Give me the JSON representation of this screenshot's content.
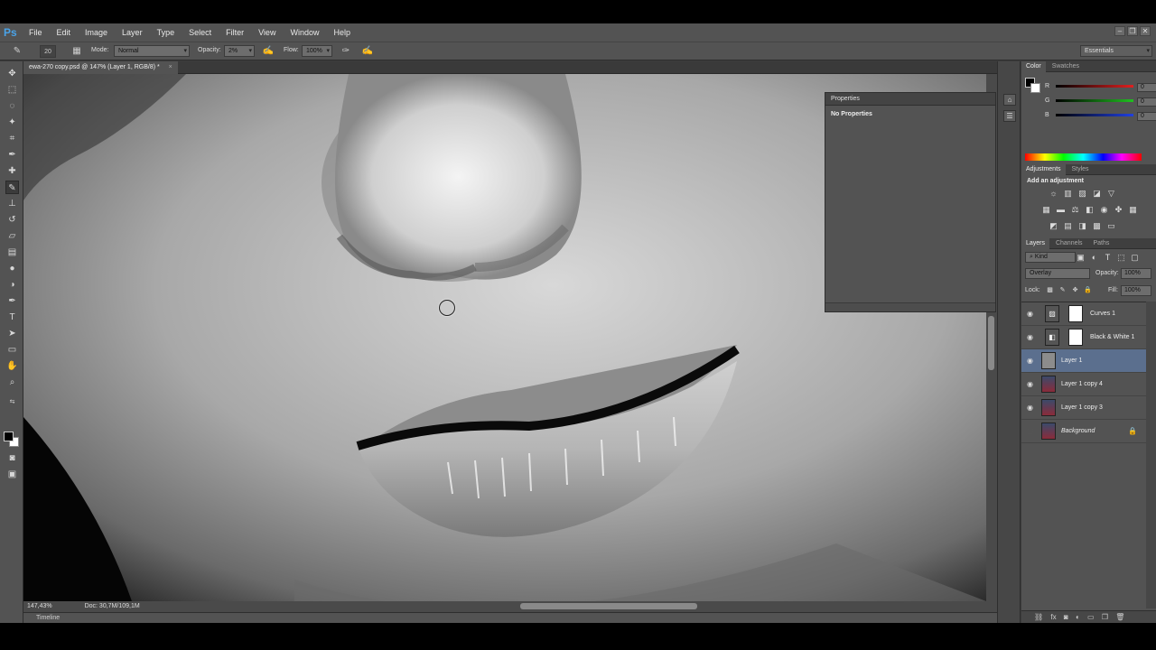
{
  "app": {
    "logo": "Ps"
  },
  "menu": [
    "File",
    "Edit",
    "Image",
    "Layer",
    "Type",
    "Select",
    "Filter",
    "View",
    "Window",
    "Help"
  ],
  "window_controls": [
    "–",
    "❐",
    "✕"
  ],
  "options": {
    "brush_size": "20",
    "mode_label": "Mode:",
    "mode_value": "Normal",
    "opacity_label": "Opacity:",
    "opacity_value": "2%",
    "flow_label": "Flow:",
    "flow_value": "100%",
    "workspace": "Essentials"
  },
  "document": {
    "tab_title": "ewa-270 copy.psd @ 147% (Layer 1, RGB/8) *",
    "close": "×",
    "zoom": "147,43%",
    "doc_size": "Doc: 30,7M/109,1M"
  },
  "timeline": {
    "label": "Timeline"
  },
  "properties": {
    "title": "Properties",
    "body": "No Properties"
  },
  "color_panel": {
    "tabs": [
      "Color",
      "Swatches"
    ],
    "sliders": [
      {
        "label": "R",
        "value": "0",
        "color": "#e02020"
      },
      {
        "label": "G",
        "value": "0",
        "color": "#20c020"
      },
      {
        "label": "B",
        "value": "0",
        "color": "#2040e0"
      }
    ]
  },
  "adjustments": {
    "tabs": [
      "Adjustments",
      "Styles"
    ],
    "heading": "Add an adjustment",
    "icons": [
      "brightness-icon",
      "levels-icon",
      "curves-icon",
      "exposure-icon",
      "gradient-triangle-icon",
      "vibrance-icon",
      "hue-saturation-icon",
      "color-balance-icon",
      "black-white-icon",
      "photo-filter-icon",
      "channel-mixer-icon",
      "color-lookup-icon",
      "invert-icon",
      "posterize-icon",
      "threshold-icon",
      "selective-color-icon",
      "gradient-map-icon"
    ]
  },
  "layers": {
    "tabs": [
      "Layers",
      "Channels",
      "Paths"
    ],
    "kind": "Kind",
    "blend_mode": "Overlay",
    "opacity_label": "Opacity:",
    "opacity_value": "100%",
    "lock_label": "Lock:",
    "fill_label": "Fill:",
    "fill_value": "100%",
    "items": [
      {
        "name": "Curves 1",
        "type": "adjustment",
        "visible": true,
        "selected": false
      },
      {
        "name": "Black & White 1",
        "type": "adjustment",
        "visible": true,
        "selected": false
      },
      {
        "name": "Layer 1",
        "type": "gray",
        "visible": true,
        "selected": true
      },
      {
        "name": "Layer 1 copy 4",
        "type": "photo",
        "visible": true,
        "selected": false
      },
      {
        "name": "Layer 1 copy 3",
        "type": "photo",
        "visible": true,
        "selected": false
      },
      {
        "name": "Background",
        "type": "photo",
        "visible": false,
        "selected": false,
        "locked": true
      }
    ]
  }
}
